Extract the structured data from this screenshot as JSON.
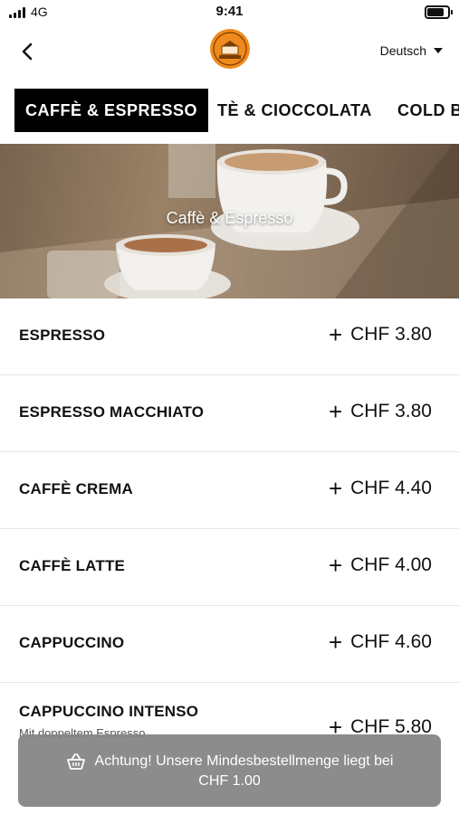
{
  "status_bar": {
    "carrier": "4G",
    "time": "9:41",
    "battery_level": 0.9
  },
  "header": {
    "back_icon": "chevron-left-icon",
    "logo_text": "CAFFÈ SPETTACOLO",
    "language": "Deutsch"
  },
  "tabs": [
    {
      "label": "CAFFÈ & ESPRESSO",
      "active": true
    },
    {
      "label": "TÈ & CIOCCOLATA",
      "active": false
    },
    {
      "label": "COLD B",
      "active": false
    }
  ],
  "hero": {
    "title": "Caffè & Espresso"
  },
  "items": [
    {
      "name": "ESPRESSO",
      "price": "CHF 3.80",
      "subtitle": ""
    },
    {
      "name": "ESPRESSO MACCHIATO",
      "price": "CHF 3.80",
      "subtitle": ""
    },
    {
      "name": "CAFFÈ CREMA",
      "price": "CHF 4.40",
      "subtitle": ""
    },
    {
      "name": "CAFFÈ LATTE",
      "price": "CHF 4.00",
      "subtitle": ""
    },
    {
      "name": "CAPPUCCINO",
      "price": "CHF 4.60",
      "subtitle": ""
    },
    {
      "name": "CAPPUCCINO INTENSO",
      "price": "CHF 5.80",
      "subtitle": "Mit doppeltem Espresso"
    }
  ],
  "toast": {
    "line1": "Achtung! Unsere Mindesbestellmenge liegt bei",
    "line2": "CHF 1.00",
    "icon": "basket-icon"
  },
  "colors": {
    "active_tab_bg": "#000000",
    "toast_bg": "#828282",
    "logo_orange": "#f08a1c"
  }
}
